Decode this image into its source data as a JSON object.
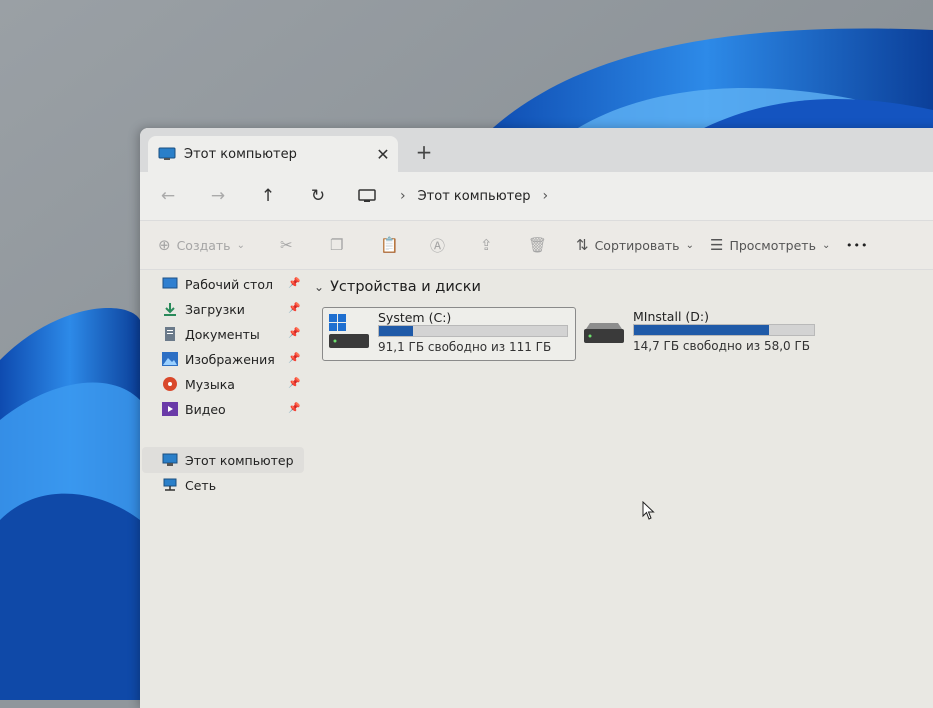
{
  "window": {
    "tab_title": "Этот компьютер",
    "new_tab_glyph": "+",
    "close_glyph": "✕"
  },
  "nav": {
    "back_glyph": "←",
    "forward_glyph": "→",
    "up_glyph": "↑",
    "refresh_glyph": "↻",
    "breadcrumb": "Этот компьютер",
    "chevron": "›"
  },
  "toolbar": {
    "create_label": "Создать",
    "sort_label": "Сортировать",
    "view_label": "Просмотреть",
    "more_glyph": "•••"
  },
  "sidebar": {
    "items": [
      {
        "label": "Рабочий стол",
        "icon": "desktop-icon"
      },
      {
        "label": "Загрузки",
        "icon": "downloads-icon"
      },
      {
        "label": "Документы",
        "icon": "documents-icon"
      },
      {
        "label": "Изображения",
        "icon": "pictures-icon"
      },
      {
        "label": "Музыка",
        "icon": "music-icon"
      },
      {
        "label": "Видео",
        "icon": "video-icon"
      }
    ],
    "this_pc": "Этот компьютер",
    "network": "Сеть"
  },
  "content": {
    "group_title": "Устройства и диски",
    "drives": [
      {
        "name": "System (C:)",
        "free_text": "91,1 ГБ свободно из 111 ГБ",
        "used_fraction": 0.18
      },
      {
        "name": "MInstall (D:)",
        "free_text": "14,7 ГБ свободно из 58,0 ГБ",
        "used_fraction": 0.75
      }
    ]
  },
  "colors": {
    "accent": "#1f5aa8",
    "wallpaper_blue": "#1f6fd6"
  }
}
